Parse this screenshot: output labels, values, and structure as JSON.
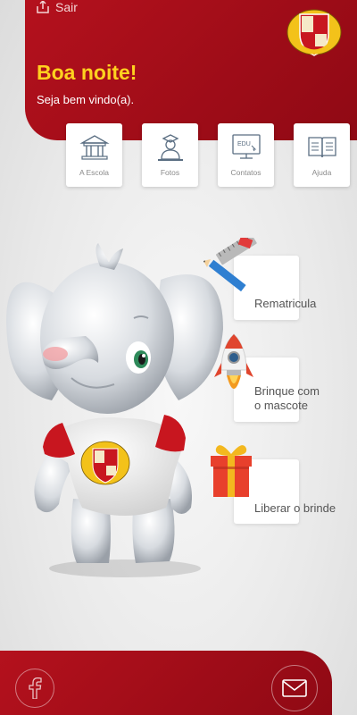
{
  "header": {
    "logout_label": "Sair",
    "greeting": "Boa noite!",
    "subgreeting": "Seja bem vindo(a)."
  },
  "quick_tiles": [
    {
      "label": "A Escola",
      "icon": "school-building-icon"
    },
    {
      "label": "Fotos",
      "icon": "graduate-photo-icon"
    },
    {
      "label": "Contatos",
      "icon": "edu-monitor-icon"
    },
    {
      "label": "Ajuda",
      "icon": "open-book-icon"
    }
  ],
  "actions": [
    {
      "label": "Rematricula",
      "icon": "ruler-pencil-icon"
    },
    {
      "label_line1": "Brinque com",
      "label_line2": "o mascote",
      "icon": "rocket-icon"
    },
    {
      "label": "Liberar o brinde",
      "icon": "gift-icon"
    }
  ],
  "bottom_bar": {
    "left_icon": "facebook-icon",
    "right_icon": "mail-icon"
  },
  "colors": {
    "brand_red": "#a60e19",
    "greeting_yellow": "#ffd21f"
  }
}
